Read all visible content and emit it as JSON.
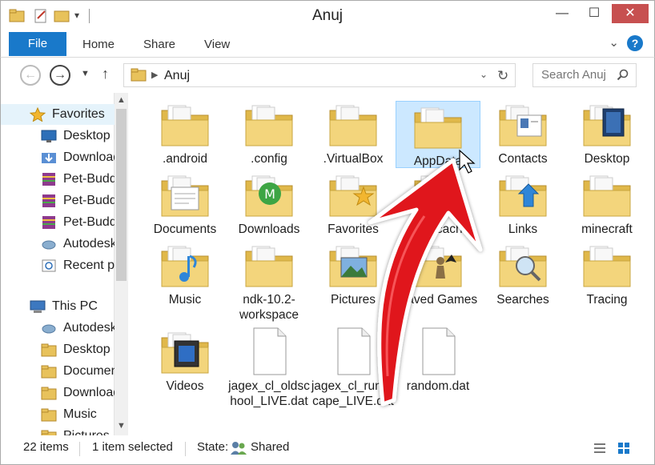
{
  "window": {
    "title": "Anuj",
    "minimize": "—",
    "maximize": "☐",
    "close": "✕"
  },
  "ribbon": {
    "tabs": [
      "File",
      "Home",
      "Share",
      "View"
    ],
    "help": "?",
    "collapse": "⌄"
  },
  "address": {
    "path": "Anuj",
    "search_placeholder": "Search Anuj"
  },
  "nav": {
    "items": [
      {
        "label": "Favorites",
        "icon": "star-icon"
      },
      {
        "label": "Desktop",
        "icon": "desktop-icon"
      },
      {
        "label": "Downloads",
        "icon": "downloads-icon"
      },
      {
        "label": "Pet-Buddy",
        "icon": "archive-icon"
      },
      {
        "label": "Pet-Buddy",
        "icon": "archive-icon"
      },
      {
        "label": "Pet-Buddy",
        "icon": "archive-icon"
      },
      {
        "label": "Autodesk",
        "icon": "cloud-icon"
      },
      {
        "label": "Recent places",
        "icon": "recent-places-icon"
      },
      {
        "label": "This PC",
        "icon": "computer-icon"
      },
      {
        "label": "Autodesk",
        "icon": "cloud-icon"
      },
      {
        "label": "Desktop",
        "icon": "folder-icon"
      },
      {
        "label": "Documents",
        "icon": "folder-icon"
      },
      {
        "label": "Downloads",
        "icon": "folder-icon"
      },
      {
        "label": "Music",
        "icon": "folder-icon"
      },
      {
        "label": "Pictures",
        "icon": "folder-icon"
      }
    ]
  },
  "files": [
    {
      "label": ".android",
      "type": "folder"
    },
    {
      "label": ".config",
      "type": "folder"
    },
    {
      "label": ".VirtualBox",
      "type": "folder"
    },
    {
      "label": "AppData",
      "type": "folder",
      "selected": true
    },
    {
      "label": "Contacts",
      "type": "folder-contacts"
    },
    {
      "label": "Desktop",
      "type": "folder-desktop"
    },
    {
      "label": "Documents",
      "type": "folder-documents"
    },
    {
      "label": "Downloads",
      "type": "folder-downloads"
    },
    {
      "label": "Favorites",
      "type": "folder-favorites"
    },
    {
      "label": "jagexcache",
      "type": "folder"
    },
    {
      "label": "Links",
      "type": "folder-links"
    },
    {
      "label": "minecraft",
      "type": "folder"
    },
    {
      "label": "Music",
      "type": "folder-music"
    },
    {
      "label": "ndk-10.2-workspace",
      "type": "folder"
    },
    {
      "label": "Pictures",
      "type": "folder-pictures"
    },
    {
      "label": "Saved Games",
      "type": "folder-games"
    },
    {
      "label": "Searches",
      "type": "folder-searches"
    },
    {
      "label": "Tracing",
      "type": "folder"
    },
    {
      "label": "Videos",
      "type": "folder-videos"
    },
    {
      "label": "jagex_cl_oldschool_LIVE.dat",
      "type": "file"
    },
    {
      "label": "jagex_cl_runescape_LIVE.dat",
      "type": "file"
    },
    {
      "label": "random.dat",
      "type": "file"
    }
  ],
  "status": {
    "count": "22 items",
    "selected": "1 item selected",
    "state_label": "State:",
    "state_value": "Shared"
  },
  "colors": {
    "accent": "#1979ca",
    "folder": "#f3d57c",
    "selection": "#cce8ff",
    "arrow": "#e0141c"
  }
}
